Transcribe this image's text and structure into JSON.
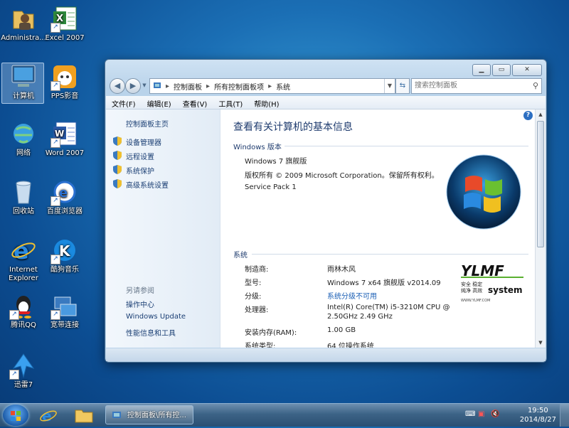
{
  "desktop": {
    "icons": [
      {
        "label": "Administra...",
        "icon": "user-folder-icon"
      },
      {
        "label": "Excel 2007",
        "icon": "excel-icon"
      },
      {
        "label": "计算机",
        "icon": "computer-icon"
      },
      {
        "label": "PPS影音",
        "icon": "pps-icon"
      },
      {
        "label": "网络",
        "icon": "network-icon"
      },
      {
        "label": "Word 2007",
        "icon": "word-icon"
      },
      {
        "label": "回收站",
        "icon": "recycle-bin-icon"
      },
      {
        "label": "百度浏览器",
        "icon": "baidu-browser-icon"
      },
      {
        "label": "Internet Explorer",
        "icon": "ie-icon"
      },
      {
        "label": "酷狗音乐",
        "icon": "kugou-icon"
      },
      {
        "label": "腾讯QQ",
        "icon": "qq-icon"
      },
      {
        "label": "宽带连接",
        "icon": "broadband-icon"
      },
      {
        "label": "迅雷7",
        "icon": "xunlei-icon"
      }
    ]
  },
  "window": {
    "address": {
      "segments": [
        "控制面板",
        "所有控制面板项",
        "系统"
      ]
    },
    "search_placeholder": "搜索控制面板",
    "menu": [
      "文件(F)",
      "编辑(E)",
      "查看(V)",
      "工具(T)",
      "帮助(H)"
    ],
    "left_pane": {
      "home": "控制面板主页",
      "links": [
        "设备管理器",
        "远程设置",
        "系统保护",
        "高级系统设置"
      ],
      "see_also_header": "另请参阅",
      "see_also": [
        "操作中心",
        "Windows Update",
        "性能信息和工具"
      ]
    },
    "main": {
      "title": "查看有关计算机的基本信息",
      "edition_header": "Windows 版本",
      "edition_name": "Windows 7 旗舰版",
      "copyright": "版权所有 © 2009 Microsoft Corporation。保留所有权利。",
      "service_pack": "Service Pack 1",
      "system_header": "系统",
      "rows": [
        {
          "key": "制造商:",
          "value": "雨林木风"
        },
        {
          "key": "型号:",
          "value": "Windows 7 x64 旗舰版 v2014.09"
        },
        {
          "key": "分级:",
          "value": "系统分级不可用"
        },
        {
          "key": "处理器:",
          "value": "Intel(R) Core(TM) i5-3210M CPU @",
          "value2": "2.50GHz   2.49 GHz"
        },
        {
          "key": "安装内存(RAM):",
          "value": "1.00 GB"
        },
        {
          "key": "系统类型:",
          "value": "64 位操作系统"
        }
      ],
      "oem_logo": {
        "brand": "YLMF",
        "tagline1": "安全 稳定",
        "tagline2": "纯净 高效",
        "word": "system",
        "url": "WWW.YLMF.COM"
      }
    }
  },
  "taskbar": {
    "task_label": "控制面板\\所有控...",
    "time": "19:50",
    "date": "2014/8/27"
  },
  "colors": {
    "accent": "#1b5fb5",
    "link": "#1b3f74"
  }
}
